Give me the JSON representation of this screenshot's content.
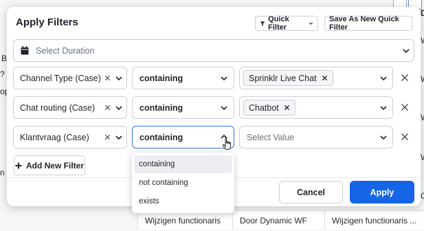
{
  "background": {
    "rows": [
      [
        "Wijzigen functionaris",
        "Door Dynamic WF",
        "Wijzigen functionaris ..."
      ]
    ],
    "edge_left": [
      "B",
      "?",
      "op",
      "n n",
      "v"
    ],
    "edge_right": [
      "D",
      "...",
      "Wi",
      "Wi",
      "Wi",
      "W",
      "W",
      "Wi",
      "W",
      "O"
    ]
  },
  "modal": {
    "title": "Apply Filters",
    "quick_filter_label": "Quick Filter",
    "save_quick_filter_label": "Save As New Quick Filter",
    "duration_placeholder": "Select Duration",
    "filters": [
      {
        "field": "Channel Type (Case)",
        "operator": "containing",
        "value": "Sprinklr Live Chat"
      },
      {
        "field": "Chat routing (Case)",
        "operator": "containing",
        "value": "Chatbot"
      },
      {
        "field": "Klantvraag (Case)",
        "operator": "containing",
        "value_placeholder": "Select Value"
      }
    ],
    "add_filter_label": "Add New Filter",
    "cancel_label": "Cancel",
    "apply_label": "Apply"
  },
  "operator_dropdown": {
    "options": [
      "containing",
      "not containing",
      "exists"
    ],
    "selected": "containing"
  },
  "colors": {
    "primary": "#1565e6",
    "focus_border": "#3872d8",
    "border": "#c9cfd6"
  },
  "icons": [
    "calendar-icon",
    "chevron-down-icon",
    "chevron-up-icon",
    "close-icon",
    "plus-icon",
    "filter-icon",
    "hand-cursor-icon"
  ]
}
